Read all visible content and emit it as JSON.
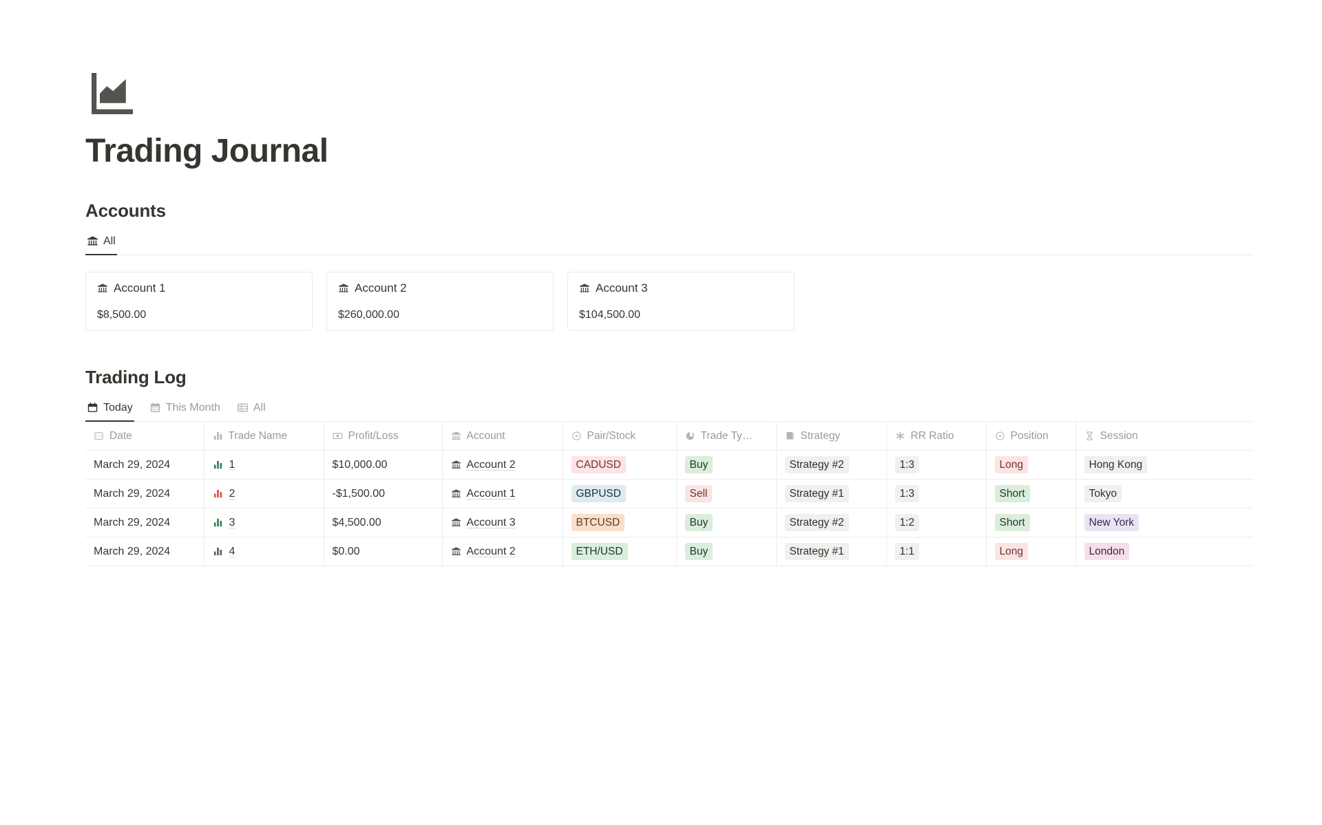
{
  "page": {
    "icon": "area-chart-icon",
    "title": "Trading Journal"
  },
  "accounts_section": {
    "heading": "Accounts",
    "views": [
      {
        "label": "All",
        "icon": "bank-icon",
        "active": true
      }
    ],
    "cards": [
      {
        "icon": "bank-icon",
        "name": "Account 1",
        "value": "$8,500.00"
      },
      {
        "icon": "bank-icon",
        "name": "Account 2",
        "value": "$260,000.00"
      },
      {
        "icon": "bank-icon",
        "name": "Account 3",
        "value": "$104,500.00"
      }
    ]
  },
  "trading_log": {
    "heading": "Trading Log",
    "views": [
      {
        "label": "Today",
        "icon": "calendar-icon",
        "active": true
      },
      {
        "label": "This Month",
        "icon": "calendar-month-icon",
        "active": false
      },
      {
        "label": "All",
        "icon": "table-icon",
        "active": false
      }
    ],
    "columns": [
      {
        "label": "Date",
        "icon": "calendar-icon"
      },
      {
        "label": "Trade Name",
        "icon": "bar-chart-icon"
      },
      {
        "label": "Profit/Loss",
        "icon": "money-icon"
      },
      {
        "label": "Account",
        "icon": "bank-icon"
      },
      {
        "label": "Pair/Stock",
        "icon": "select-icon"
      },
      {
        "label": "Trade Ty…",
        "icon": "pie-chart-icon"
      },
      {
        "label": "Strategy",
        "icon": "book-icon"
      },
      {
        "label": "RR Ratio",
        "icon": "asterisk-icon"
      },
      {
        "label": "Position",
        "icon": "select-icon"
      },
      {
        "label": "Session",
        "icon": "hourglass-icon"
      }
    ],
    "rows": [
      {
        "date": "March 29, 2024",
        "trade_name": "1",
        "trade_icon_color": "#2f7d4f",
        "profit_loss": "$10,000.00",
        "account": "Account 2",
        "pair": "CADUSD",
        "pair_color": "red",
        "trade_type": "Buy",
        "trade_type_color": "green",
        "strategy": "Strategy #2",
        "strategy_color": "gray",
        "rr_ratio": "1:3",
        "rr_color": "gray",
        "position": "Long",
        "position_color": "red",
        "session": "Hong Kong",
        "session_color": "gray"
      },
      {
        "date": "March 29, 2024",
        "trade_name": "2",
        "trade_icon_color": "#d94f45",
        "profit_loss": "-$1,500.00",
        "account": "Account 1",
        "pair": "GBPUSD",
        "pair_color": "blue",
        "trade_type": "Sell",
        "trade_type_color": "red",
        "strategy": "Strategy #1",
        "strategy_color": "gray",
        "rr_ratio": "1:3",
        "rr_color": "gray",
        "position": "Short",
        "position_color": "green",
        "session": "Tokyo",
        "session_color": "gray"
      },
      {
        "date": "March 29, 2024",
        "trade_name": "3",
        "trade_icon_color": "#2f7d4f",
        "profit_loss": "$4,500.00",
        "account": "Account 3",
        "pair": "BTCUSD",
        "pair_color": "orange",
        "trade_type": "Buy",
        "trade_type_color": "green",
        "strategy": "Strategy #2",
        "strategy_color": "gray",
        "rr_ratio": "1:2",
        "rr_color": "gray",
        "position": "Short",
        "position_color": "green",
        "session": "New York",
        "session_color": "purple"
      },
      {
        "date": "March 29, 2024",
        "trade_name": "4",
        "trade_icon_color": "#5b5a57",
        "profit_loss": "$0.00",
        "account": "Account 2",
        "pair": "ETH/USD",
        "pair_color": "green",
        "trade_type": "Buy",
        "trade_type_color": "green",
        "strategy": "Strategy #1",
        "strategy_color": "gray",
        "rr_ratio": "1:1",
        "rr_color": "gray",
        "position": "Long",
        "position_color": "red",
        "session": "London",
        "session_color": "pink"
      }
    ]
  },
  "colors": {
    "text": "#37352f",
    "muted": "#9b9a97",
    "border": "#eeedec",
    "green": "#2f7d4f",
    "red": "#d94f45"
  }
}
